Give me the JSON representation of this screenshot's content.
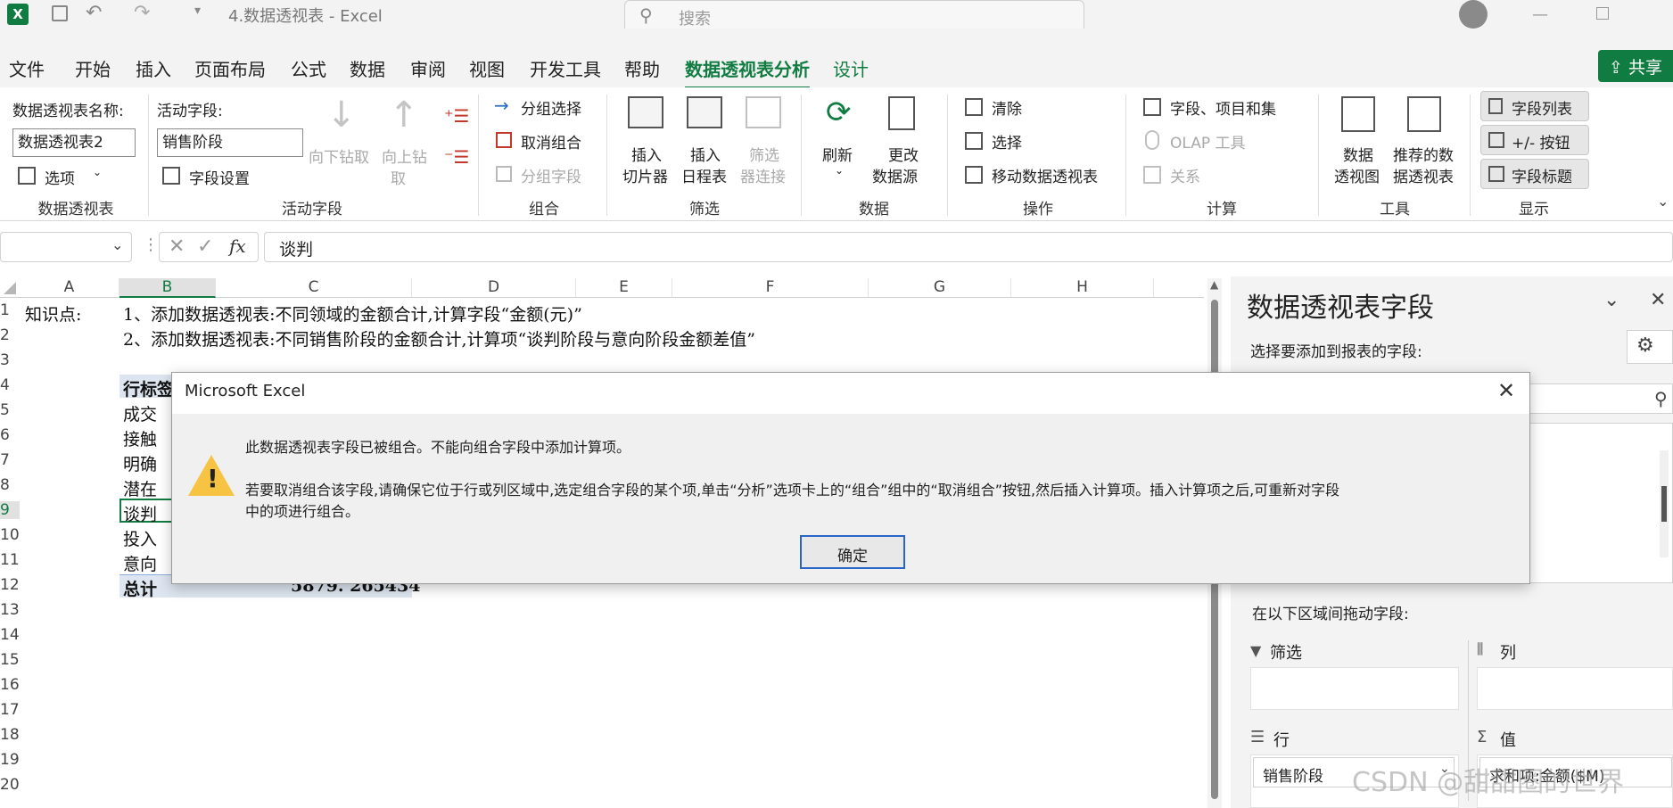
{
  "titlebar": {
    "doc_title": "4.数据透视表  -  Excel",
    "search_placeholder": "搜索"
  },
  "menu": [
    "文件",
    "开始",
    "插入",
    "页面布局",
    "公式",
    "数据",
    "审阅",
    "视图",
    "开发工具",
    "帮助",
    "数据透视表分析",
    "设计"
  ],
  "share_label": "共享",
  "ribbon": {
    "pivot_name_label": "数据透视表名称:",
    "pivot_name_value": "数据透视表2",
    "options_label": "选项",
    "group_pivot": "数据透视表",
    "active_field_label": "活动字段:",
    "active_field_value": "销售阶段",
    "field_settings": "字段设置",
    "drill_down": "向下钻取",
    "drill_up_1": "向上钻",
    "drill_up_2": "取",
    "group_active": "活动字段",
    "group_select": "分组选择",
    "ungroup": "取消组合",
    "group_field": "分组字段",
    "group_group": "组合",
    "insert_slicer_1": "插入",
    "insert_slicer_2": "切片器",
    "insert_timeline_1": "插入",
    "insert_timeline_2": "日程表",
    "filter_conn_1": "筛选",
    "filter_conn_2": "器连接",
    "group_filter": "筛选",
    "refresh": "刷新",
    "change_source_1": "更改",
    "change_source_2": "数据源",
    "group_data": "数据",
    "clear": "清除",
    "select": "选择",
    "move_pivot": "移动数据透视表",
    "group_actions": "操作",
    "fields_items": "字段、项目和集",
    "olap": "OLAP 工具",
    "relations": "关系",
    "group_calc": "计算",
    "pivot_chart_1": "数据",
    "pivot_chart_2": "透视图",
    "recommended_1": "推荐的数",
    "recommended_2": "据透视表",
    "group_tools": "工具",
    "field_list": "字段列表",
    "plus_minus": "+/- 按钮",
    "field_headers": "字段标题",
    "group_show": "显示"
  },
  "formula": {
    "content": "谈判",
    "fx": "fx"
  },
  "grid": {
    "columns": [
      "A",
      "B",
      "C",
      "D",
      "E",
      "F",
      "G",
      "H"
    ],
    "rows": [
      "1",
      "2",
      "3",
      "4",
      "5",
      "6",
      "7",
      "8",
      "9",
      "10",
      "11",
      "12",
      "13",
      "14",
      "15",
      "16",
      "17",
      "18",
      "19",
      "20"
    ],
    "a1": "知识点:",
    "b1": "1、添加数据透视表:不同领域的金额合计,计算字段“金额(元)”",
    "b2": "2、添加数据透视表:不同销售阶段的金额合计,计算项“谈判阶段与意向阶段金额差值”",
    "b4": "行标签",
    "b5": "成交",
    "b6": "接触",
    "b7": "明确",
    "b8": "潜在",
    "b9": "谈判",
    "b10": "投入",
    "b11": "意向",
    "b12": "总计",
    "c12": "5879. 265434"
  },
  "dialog": {
    "title": "Microsoft Excel",
    "line1": "此数据透视表字段已被组合。不能向组合字段中添加计算项。",
    "line2a": "若要取消组合该字段,请确保它位于行或列区域中,选定组合字段的某个项,单击“分析”选项卡上的“组合”组中的“取消组合”按钮,然后插入计算项。插入计算项之后,可重新对字段",
    "line2b": "中的项进行组合。",
    "ok": "确定"
  },
  "pane": {
    "title": "数据透视表字段",
    "choose_label": "选择要添加到报表的字段:",
    "drag_label": "在以下区域间拖动字段:",
    "filters": "筛选",
    "columns": "列",
    "rows": "行",
    "values": "值",
    "row_field": "销售阶段",
    "value_field": "求和项:金额($M)"
  },
  "watermark": "CSDN @甜甜圈的世界",
  "colors": {
    "excel_green": "#107c41",
    "pivot_header_bg": "#dde5f0"
  }
}
